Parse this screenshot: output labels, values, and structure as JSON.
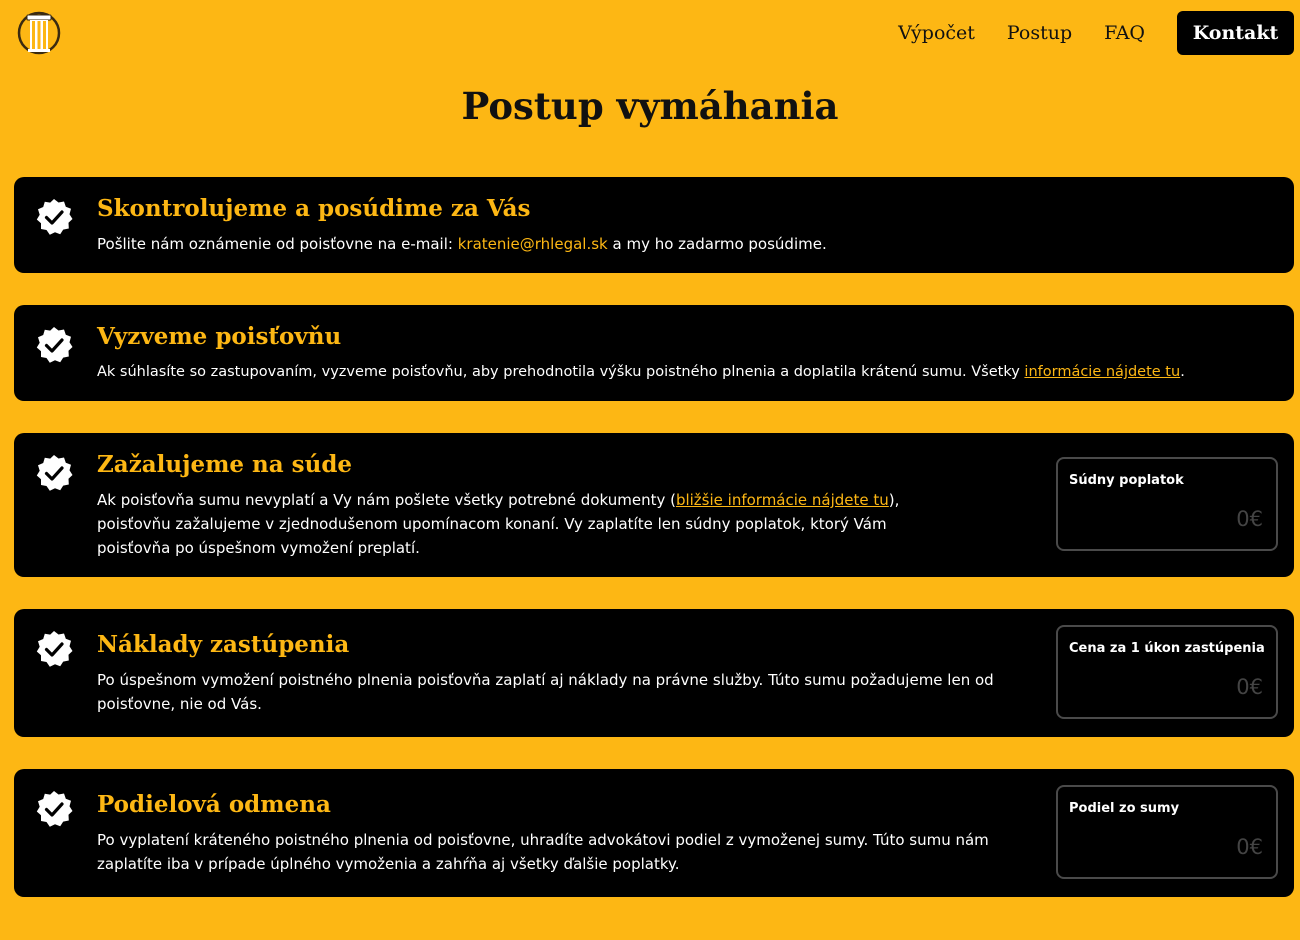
{
  "nav": {
    "items": [
      "Výpočet",
      "Postup",
      "FAQ"
    ],
    "contact": "Kontakt"
  },
  "page_title": "Postup vymáhania",
  "steps": [
    {
      "title": "Skontrolujeme a posúdime za Vás",
      "text_before": "Pošlite nám oznámenie od poisťovne na e-mail: ",
      "link": "kratenie@rhlegal.sk",
      "text_after": " a my ho zadarmo posúdime."
    },
    {
      "title": "Vyzveme poisťovňu",
      "text_before": "Ak súhlasíte so zastupovaním, vyzveme poisťovňu, aby prehodnotila výšku poistného plnenia a doplatila krátenú sumu. Všetky ",
      "link": "informácie nájdete tu",
      "text_after": "."
    },
    {
      "title": "Zažalujeme na súde",
      "text_before": "Ak poisťovňa sumu nevyplatí a Vy nám pošlete všetky potrebné dokumenty (",
      "link": "bližšie informácie nájdete tu",
      "text_after": "), poisťovňu zažalujeme v zjednodušenom upomínacom konaní. Vy zaplatíte len súdny poplatok, ktorý Vám poisťovňa po úspešnom vymožení preplatí.",
      "box_label": "Súdny poplatok",
      "box_value": "0€"
    },
    {
      "title": "Náklady zastúpenia",
      "text": "Po úspešnom vymožení poistného plnenia poisťovňa zaplatí aj náklady na právne služby. Túto sumu požadujeme len od poisťovne, nie od Vás.",
      "box_label": "Cena za 1 úkon zastúpenia",
      "box_value": "0€"
    },
    {
      "title": "Podielová odmena",
      "text": "Po vyplatení kráteného poistného plnenia od poisťovne, uhradíte advokátovi podiel z vymoženej sumy. Túto sumu nám zaplatíte iba v prípade úplného vymoženia a zahŕňa aj všetky ďalšie poplatky.",
      "box_label": "Podiel zo sumy",
      "box_value": "0€"
    }
  ]
}
